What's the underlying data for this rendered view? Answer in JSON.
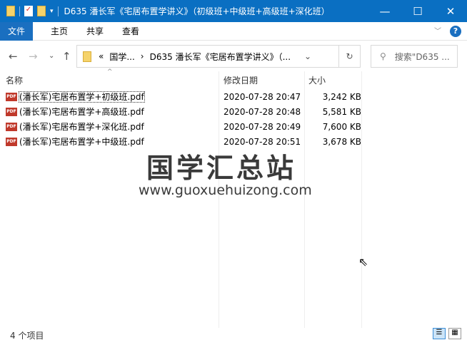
{
  "window": {
    "title": "D635 潘长军《宅居布置学讲义》（初级班+中级班+高级班+深化班）",
    "minimize": "—",
    "maximize": "☐",
    "close": "✕"
  },
  "ribbon": {
    "tabs": [
      "文件",
      "主页",
      "共享",
      "查看"
    ],
    "help": "?"
  },
  "nav": {
    "back": "←",
    "forward": "→",
    "recent": "⌄",
    "up": "↑",
    "breadcrumb": [
      "«",
      "国学...",
      "›",
      "D635 潘长军《宅居布置学讲义》（..."
    ],
    "dropdown": "⌄",
    "refresh": "↻",
    "search_placeholder": "搜索\"D635 ..."
  },
  "columns": {
    "name": "名称",
    "date": "修改日期",
    "size": "大小"
  },
  "files": [
    {
      "name": "(潘长军)宅居布置学+初级班.pdf",
      "date": "2020-07-28 20:47",
      "size": "3,242 KB"
    },
    {
      "name": "(潘长军)宅居布置学+高级班.pdf",
      "date": "2020-07-28 20:48",
      "size": "5,581 KB"
    },
    {
      "name": "(潘长军)宅居布置学+深化班.pdf",
      "date": "2020-07-28 20:49",
      "size": "7,600 KB"
    },
    {
      "name": "(潘长军)宅居布置学+中级班.pdf",
      "date": "2020-07-28 20:51",
      "size": "3,678 KB"
    }
  ],
  "pdf_icon": "PDF",
  "watermark": {
    "title": "国学汇总站",
    "url": "www.guoxuehuizong.com"
  },
  "status": {
    "count": "4 个项目"
  }
}
